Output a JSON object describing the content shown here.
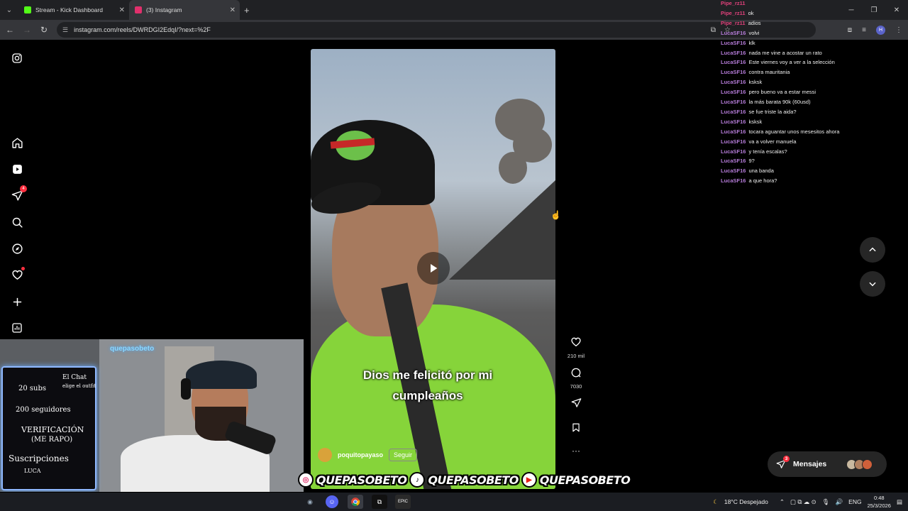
{
  "browser": {
    "tabs": [
      {
        "title": "Stream - Kick Dashboard",
        "favicon_color": "#53fc18",
        "active": false
      },
      {
        "title": "(3) Instagram",
        "favicon_color": "#e1306c",
        "active": true
      }
    ],
    "url": "instagram.com/reels/DWRDGI2EdqI/?next=%2F",
    "profile_initial": "H"
  },
  "sidebar": {
    "items": [
      {
        "name": "instagram-logo"
      },
      {
        "name": "home"
      },
      {
        "name": "reels"
      },
      {
        "name": "messages",
        "badge": "4"
      },
      {
        "name": "search"
      },
      {
        "name": "explore"
      },
      {
        "name": "notifications"
      },
      {
        "name": "create"
      },
      {
        "name": "dashboard"
      }
    ]
  },
  "reel": {
    "caption_line1": "Dios me felicitó por mi",
    "caption_line2": "cumpleaños",
    "author": "poquitopayaso",
    "follow_label": "Seguir",
    "likes": "210 mil",
    "comments": "7030"
  },
  "chat": {
    "lines": [
      {
        "user": "Pipe_rz11",
        "msg": "",
        "pipe": true
      },
      {
        "user": "Pipe_rz11",
        "msg": "ok",
        "pipe": true
      },
      {
        "user": "Pipe_rz11",
        "msg": "adios",
        "pipe": true
      },
      {
        "user": "LucaSF16",
        "msg": "volvi"
      },
      {
        "user": "LucaSF16",
        "msg": "klk"
      },
      {
        "user": "LucaSF16",
        "msg": "nada me vine a acostar un rato"
      },
      {
        "user": "LucaSF16",
        "msg": "Este viernes voy a ver a la selección"
      },
      {
        "user": "LucaSF16",
        "msg": "contra mauritania"
      },
      {
        "user": "LucaSF16",
        "msg": "ksksk"
      },
      {
        "user": "LucaSF16",
        "msg": "pero bueno va a estar messi"
      },
      {
        "user": "LucaSF16",
        "msg": "la más barata 90k (60usd)"
      },
      {
        "user": "LucaSF16",
        "msg": "se fue triste la aida?"
      },
      {
        "user": "LucaSF16",
        "msg": "ksksk"
      },
      {
        "user": "LucaSF16",
        "msg": "tocara aguantar unos mesesitos ahora"
      },
      {
        "user": "LucaSF16",
        "msg": "va a volver manuela"
      },
      {
        "user": "LucaSF16",
        "msg": "y tenía escalas?"
      },
      {
        "user": "LucaSF16",
        "msg": "9?"
      },
      {
        "user": "LucaSF16",
        "msg": "una banda"
      },
      {
        "user": "LucaSF16",
        "msg": "a que hora?"
      }
    ]
  },
  "messages_pill": {
    "label": "Mensajes",
    "badge": "3"
  },
  "webcam": {
    "tag": "quepasobeto",
    "board_lines": [
      "El Chat",
      "elige el outfit",
      "20 subs",
      "200 seguidores",
      "VERIFICACIÓN",
      "(ME RAPO)",
      "Suscripciones",
      "LUCA"
    ]
  },
  "social": [
    {
      "icon": "instagram-icon",
      "handle": "QUEPASOBETO"
    },
    {
      "icon": "tiktok-icon",
      "handle": "QUEPASOBETO"
    },
    {
      "icon": "youtube-icon",
      "handle": "QUEPASOBETO"
    }
  ],
  "taskbar": {
    "weather": "18°C Despejado",
    "lang": "ENG",
    "time": "0:48",
    "date": "25/3/2026"
  }
}
